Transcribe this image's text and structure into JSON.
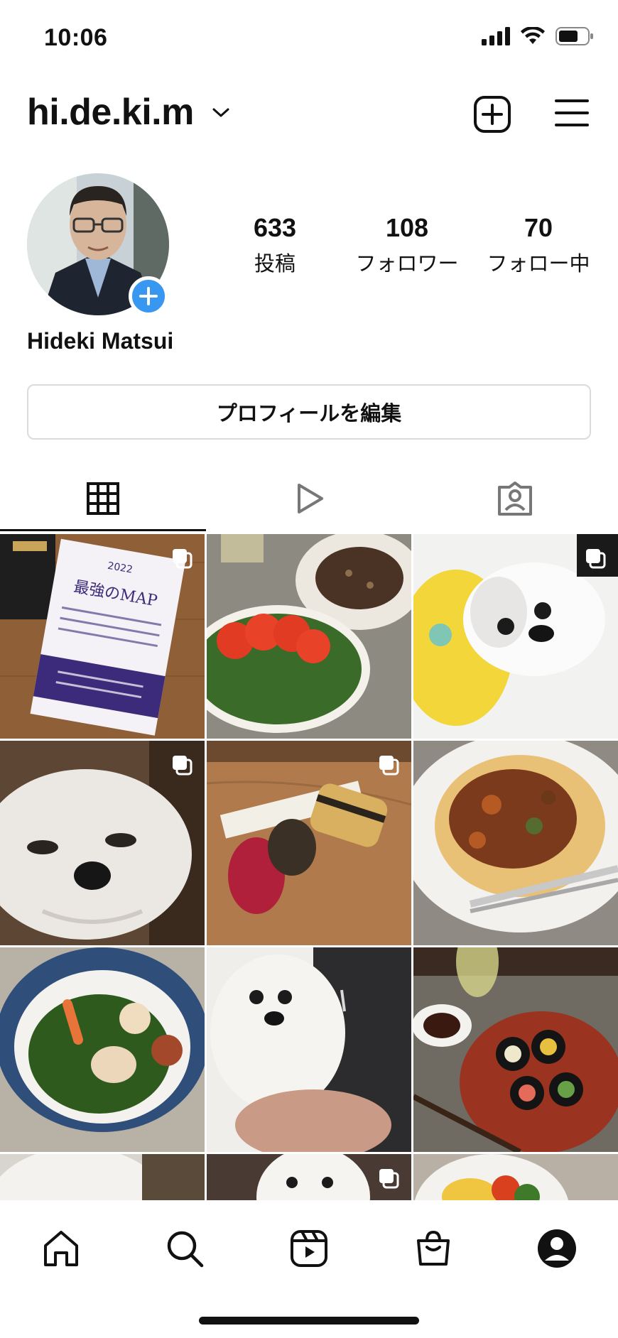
{
  "status_bar": {
    "time": "10:06"
  },
  "header": {
    "username": "hi.de.ki.m"
  },
  "profile": {
    "display_name": "Hideki Matsui",
    "stats": [
      {
        "value": "633",
        "label": "投稿"
      },
      {
        "value": "108",
        "label": "フォロワー"
      },
      {
        "value": "70",
        "label": "フォロー中"
      }
    ],
    "edit_button": "プロフィールを編集"
  },
  "tabs": [
    {
      "icon": "grid-icon",
      "active": true
    },
    {
      "icon": "reels-play-icon",
      "active": false
    },
    {
      "icon": "tagged-person-icon",
      "active": false
    }
  ],
  "posts": [
    {
      "subject": "book cover",
      "cover_small": "2022",
      "cover_title": "最強のMAP",
      "multi": true
    },
    {
      "subject": "steak and tomato salad",
      "multi": false
    },
    {
      "subject": "white shih tzu on yellow cushion",
      "multi": true
    },
    {
      "subject": "shih tzu close-up",
      "multi": true
    },
    {
      "subject": "sushi on wooden board",
      "multi": true
    },
    {
      "subject": "pasta with meat sauce",
      "multi": false
    },
    {
      "subject": "chicken and greens rice bowl",
      "multi": false
    },
    {
      "subject": "shih tzu held in arms",
      "multi": false
    },
    {
      "subject": "sushi rolls plate",
      "multi": false
    },
    {
      "subject": "dog partial",
      "multi": false
    },
    {
      "subject": "dog partial",
      "multi": true
    },
    {
      "subject": "food partial",
      "multi": false
    }
  ],
  "bottom_nav": [
    "home-icon",
    "search-icon",
    "reels-icon",
    "shop-icon",
    "profile-icon"
  ],
  "colors": {
    "accent": "#3897f0",
    "text": "#111111",
    "border": "#dbdbdb"
  }
}
